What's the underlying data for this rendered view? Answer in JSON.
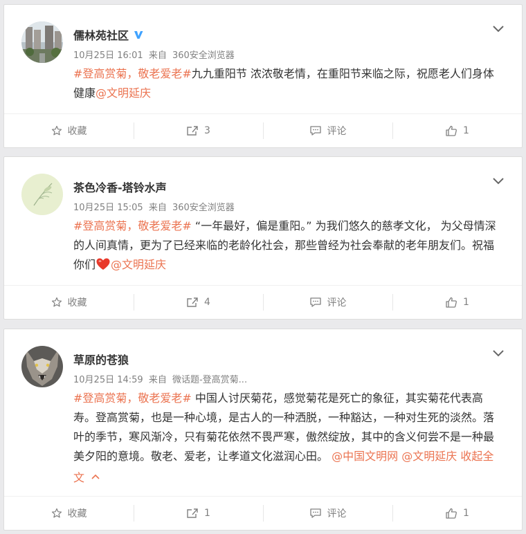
{
  "colors": {
    "accent": "#eb7350",
    "verified": "#3fa2ff",
    "heart": "#e8392b"
  },
  "posts": [
    {
      "username": "儒林苑社区",
      "verified": true,
      "time": "10月25日 16:01",
      "from_label": "来自",
      "source": "360安全浏览器",
      "hashtag": "#登高赏菊，敬老爱老#",
      "body": "九九重阳节 浓浓敬老情，在重阳节来临之际，祝愿老人们身体健康",
      "mention": "@文明延庆",
      "collect_label": "收藏",
      "repost_count": "3",
      "comment_label": "评论",
      "like_count": "1"
    },
    {
      "username": "茶色冷香-塔铃水声",
      "time": "10月25日 15:05",
      "from_label": "来自",
      "source": "360安全浏览器",
      "hashtag": "#登高赏菊，敬老爱老#",
      "body": " “一年最好，偏是重阳。” 为我们悠久的慈孝文化， 为父母情深的人间真情，更为了已经来临的老龄化社会，那些曾经为社会奉献的老年朋友们。祝福你们",
      "heart_icon": "red-heart-emoji",
      "mention": "@文明延庆",
      "collect_label": "收藏",
      "repost_count": "4",
      "comment_label": "评论",
      "like_count": "1"
    },
    {
      "username": "草原的苍狼",
      "time": "10月25日 14:59",
      "from_label": "来自",
      "source": "微话题-登高赏菊...",
      "hashtag": "#登高赏菊，敬老爱老#",
      "body": " 中国人讨厌菊花，感觉菊花是死亡的象征，其实菊花代表高寿。登高赏菊，也是一种心境，是古人的一种洒脱，一种豁达，一种对生死的淡然。落叶的季节，寒风渐冷，只有菊花依然不畏严寒，傲然绽放，其中的含义何尝不是一种最美夕阳的意境。敬老、爱老，让孝道文化滋润心田。",
      "mention": "@中国文明网",
      "mention2": "@文明延庆",
      "collapse_label": "收起全文",
      "collect_label": "收藏",
      "repost_count": "1",
      "comment_label": "评论",
      "like_count": "1"
    }
  ]
}
